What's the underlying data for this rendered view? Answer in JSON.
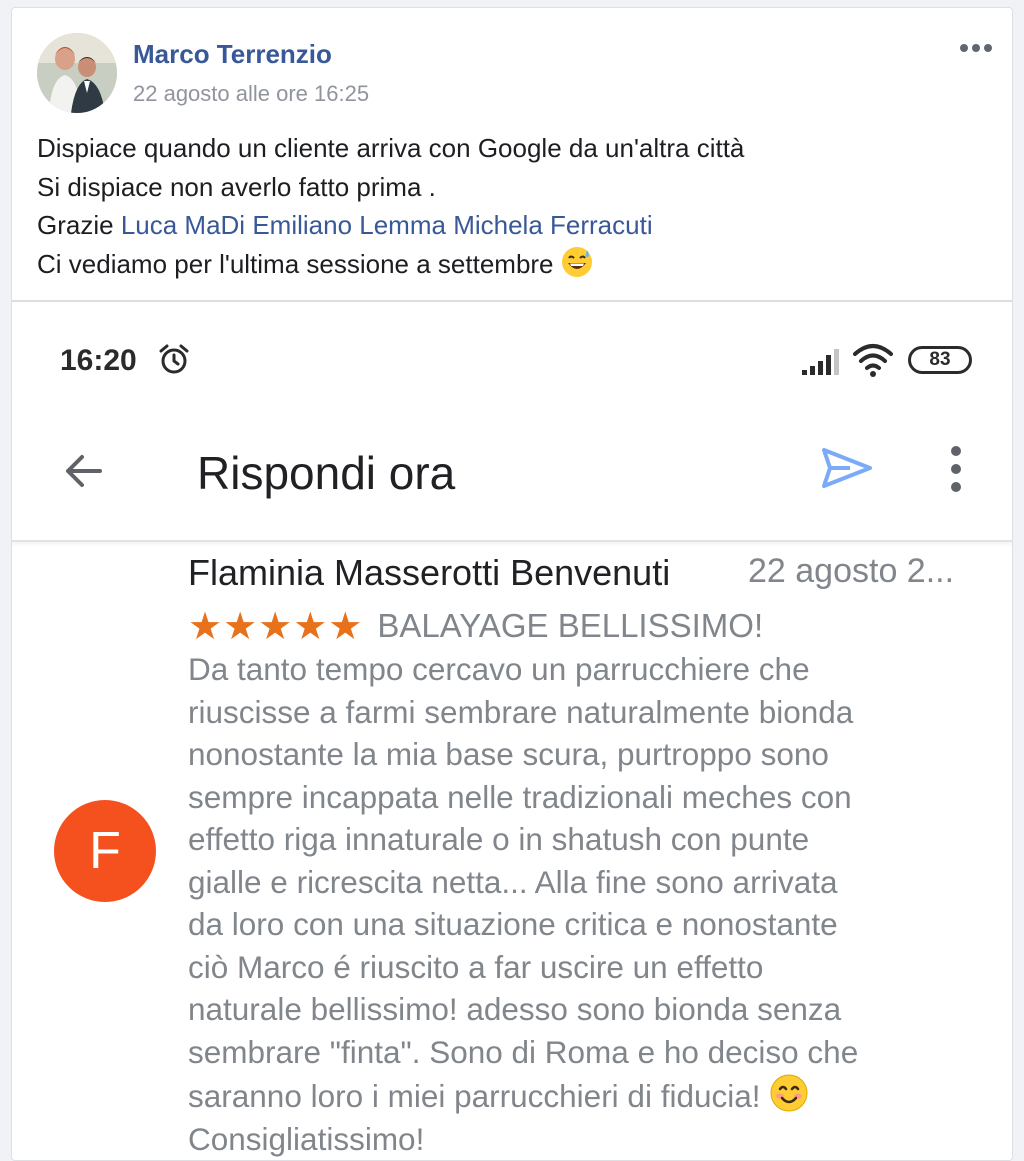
{
  "post": {
    "author": "Marco Terrenzio",
    "timestamp": "22 agosto alle ore 16:25",
    "more_icon": "more-horizontal-icon",
    "text": {
      "line1": "Dispiace quando un cliente arriva con Google da un'altra città",
      "line2": "Si dispiace non averlo fatto prima .",
      "line3_prefix": "Grazie ",
      "mentions": [
        "Luca MaDi",
        "Emiliano Lemma",
        "Michela Ferracuti"
      ],
      "line4": "Ci vediamo per l'ultima sessione a settembre",
      "line4_emoji": "grinning-sweat-emoji"
    }
  },
  "screenshot": {
    "status_bar": {
      "time": "16:20",
      "alarm_icon": "alarm-clock-icon",
      "signal_icon": "cell-signal-icon",
      "wifi_icon": "wifi-icon",
      "battery": "83"
    },
    "app_bar": {
      "back_icon": "arrow-back-icon",
      "title": "Rispondi ora",
      "send_icon": "send-icon",
      "menu_icon": "more-vertical-icon"
    },
    "review": {
      "avatar_letter": "F",
      "reviewer": "Flaminia Masserotti Benvenuti",
      "date": "22 agosto 2...",
      "stars": "★★★★★",
      "rating": 5,
      "title": "BALAYAGE BELLISSIMO!",
      "body_lines": [
        "Da tanto tempo cercavo un parrucchiere che",
        "riuscisse a farmi sembrare naturalmente bionda",
        "nonostante la mia base scura, purtroppo sono",
        "sempre incappata nelle tradizionali meches con",
        "effetto riga innaturale o in shatush con punte",
        "gialle e ricrescita netta... Alla fine sono arrivata",
        "da loro con una situazione critica e nonostante",
        "ciò Marco é riuscito a far uscire un effetto",
        "naturale bellissimo! adesso sono bionda senza",
        "sembrare \"finta\". Sono di Roma e ho deciso che",
        "saranno loro i miei parrucchieri di fiducia!",
        "Consigliatissimo!"
      ],
      "smile_emoji": "smiling-face-emoji"
    }
  },
  "colors": {
    "link": "#385898",
    "star": "#e8711c",
    "avatar_bg": "#f4511e",
    "send": "#7baaf7"
  }
}
